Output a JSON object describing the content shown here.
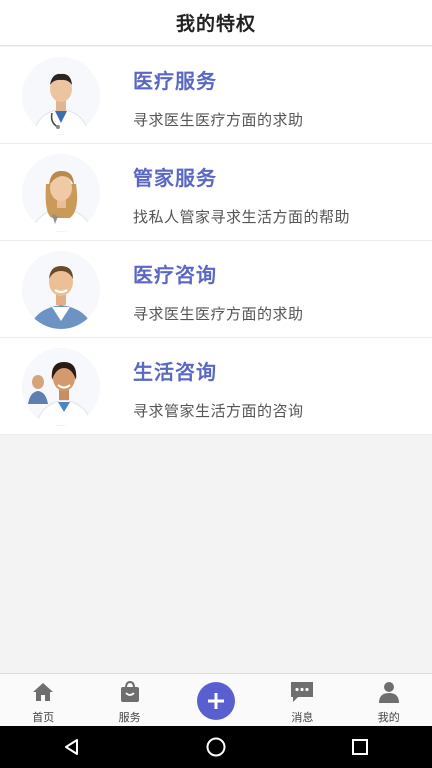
{
  "header": {
    "title": "我的特权"
  },
  "items": [
    {
      "title": "医疗服务",
      "desc": "寻求医生医疗方面的求助",
      "avatar_icon": "doctor-male-portrait"
    },
    {
      "title": "管家服务",
      "desc": "找私人管家寻求生活方面的帮助",
      "avatar_icon": "housekeeper-female-portrait"
    },
    {
      "title": "医疗咨询",
      "desc": "寻求医生医疗方面的求助",
      "avatar_icon": "doctor-male-young-portrait"
    },
    {
      "title": "生活咨询",
      "desc": "寻求管家生活方面的咨询",
      "avatar_icon": "doctor-female-portrait"
    }
  ],
  "tabbar": {
    "tabs": [
      {
        "label": "首页",
        "icon": "home-icon"
      },
      {
        "label": "服务",
        "icon": "bag-icon"
      },
      {
        "label": "",
        "icon": "plus-icon"
      },
      {
        "label": "消息",
        "icon": "chat-icon"
      },
      {
        "label": "我的",
        "icon": "user-icon"
      }
    ]
  },
  "colors": {
    "accent": "#5a68c4",
    "plus_button": "#5a5fd0",
    "background": "#f3f3f3"
  },
  "system_nav": {
    "buttons": [
      "back",
      "home",
      "recents"
    ]
  }
}
